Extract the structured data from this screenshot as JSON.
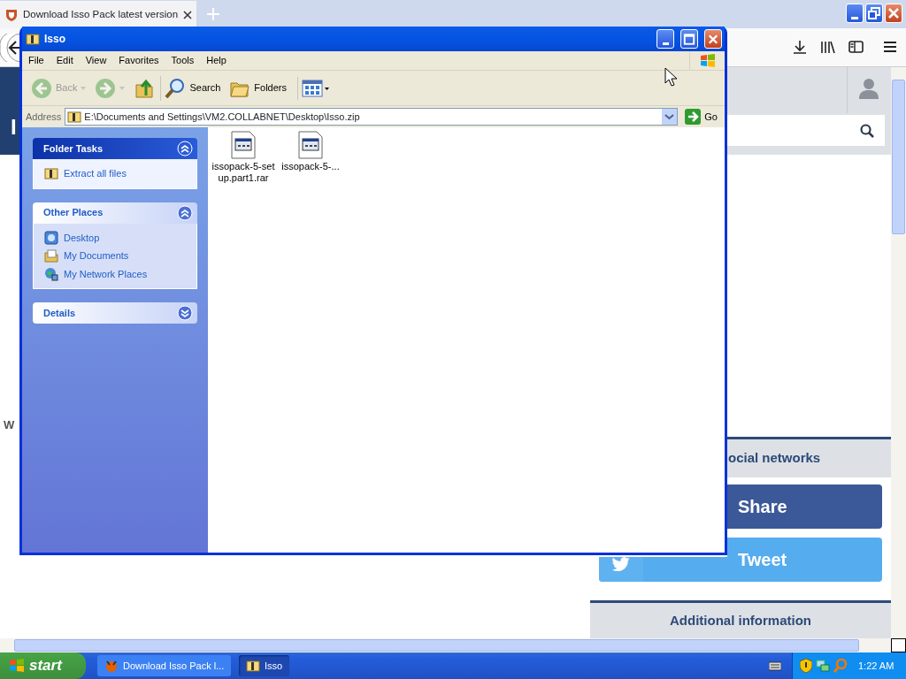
{
  "browser": {
    "tabs": [
      {
        "label": "Download Isso Pack latest version",
        "selected": true
      }
    ],
    "page": {
      "header_letter": "I",
      "body_letter": "W",
      "social_heading": "ocial networks",
      "share_buttons": [
        {
          "kind": "facebook",
          "label": "Share"
        },
        {
          "kind": "twitter",
          "label": "Tweet"
        }
      ],
      "info_heading": "Additional information"
    }
  },
  "explorer": {
    "title": "Isso",
    "menu": [
      "File",
      "Edit",
      "View",
      "Favorites",
      "Tools",
      "Help"
    ],
    "toolbar": [
      {
        "kind": "back",
        "label": "Back",
        "disabled": true
      },
      {
        "kind": "forward",
        "disabled": true
      },
      {
        "kind": "up",
        "disabled": false
      },
      {
        "kind": "search",
        "label": "Search",
        "disabled": false
      },
      {
        "kind": "folders",
        "label": "Folders",
        "disabled": false
      },
      {
        "kind": "views",
        "disabled": false
      }
    ],
    "address": {
      "label": "Address",
      "value": "E:\\Documents and Settings\\VM2.COLLABNET\\Desktop\\Isso.zip",
      "go": "Go"
    },
    "panels": [
      {
        "kind": "special",
        "title": "Folder Tasks",
        "expanded": true,
        "items": [
          {
            "kind": "zip",
            "label": "Extract all files"
          }
        ]
      },
      {
        "kind": "plain",
        "title": "Other Places",
        "expanded": true,
        "items": [
          {
            "kind": "desktop",
            "label": "Desktop"
          },
          {
            "kind": "documents",
            "label": "My Documents"
          },
          {
            "kind": "network",
            "label": "My Network Places"
          }
        ]
      },
      {
        "kind": "plain",
        "title": "Details",
        "expanded": false
      }
    ],
    "files": [
      {
        "name": "issopack-5-setup.part1.rar",
        "selected": false
      },
      {
        "name": "issopack-5-...",
        "selected": false
      }
    ]
  },
  "taskbar": {
    "start": "start",
    "tasks": [
      {
        "kind": "firefox",
        "label": "Download Isso Pack l...",
        "selected": false
      },
      {
        "kind": "folder",
        "label": "Isso",
        "selected": true
      }
    ],
    "clock": "1:22 AM"
  }
}
